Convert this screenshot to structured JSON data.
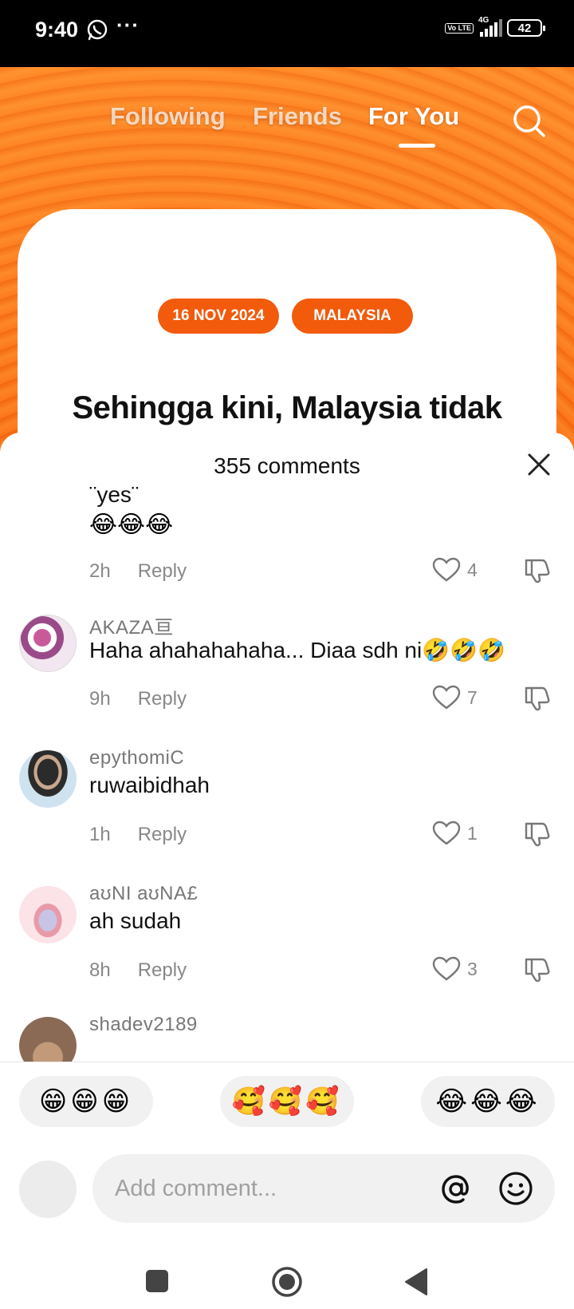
{
  "status_bar": {
    "time": "9:40",
    "dots": "···",
    "volte": "Vo LTE",
    "network": "4G",
    "battery": "42"
  },
  "top_tabs": {
    "following": "Following",
    "friends": "Friends",
    "for_you": "For You"
  },
  "news_card": {
    "date_pill": "16 NOV 2024",
    "region_pill": "MALAYSIA",
    "headline": "Sehingga kini, Malaysia tidak pernah iktiraf negara haram Israel - Fahmi"
  },
  "sheet": {
    "title": "355 comments"
  },
  "comments": [
    {
      "username": "",
      "text": "¨yes¨",
      "emoji": "😂😂😂",
      "time": "2h",
      "reply": "Reply",
      "likes": "4"
    },
    {
      "username": "AKAZA亘",
      "text": "Haha ahahahahaha... Diaa sdh ni🤣🤣🤣",
      "time": "9h",
      "reply": "Reply",
      "likes": "7"
    },
    {
      "username": "epythomiC",
      "text": "ruwaibidhah",
      "time": "1h",
      "reply": "Reply",
      "likes": "1"
    },
    {
      "username": "aʊNI aʊNA£",
      "text": "ah sudah",
      "time": "8h",
      "reply": "Reply",
      "likes": "3"
    },
    {
      "username": "shadev2189"
    }
  ],
  "quick_emojis": [
    "😁😁😁",
    "🥰🥰🥰",
    "😂😂😂"
  ],
  "composer": {
    "placeholder": "Add comment..."
  },
  "colors": {
    "accent": "#f25a0c",
    "background_orange": "#ff7a1a"
  }
}
